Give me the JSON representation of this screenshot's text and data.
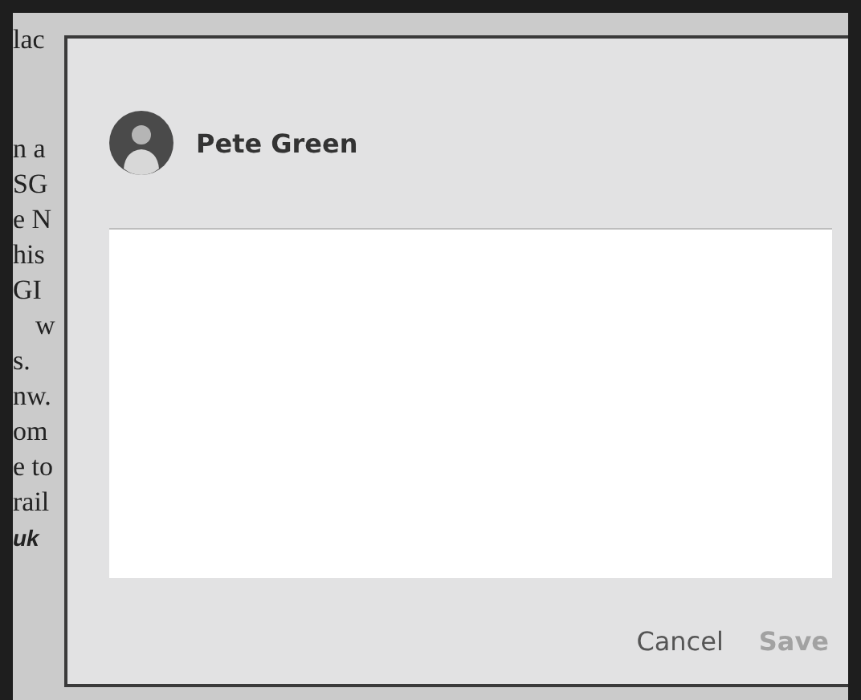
{
  "background_page": {
    "lines": [
      {
        "text": "lac",
        "kind": "plain"
      },
      {
        "text": "n a",
        "kind": "plain"
      },
      {
        "text": "SG",
        "kind": "plain"
      },
      {
        "text": "e N",
        "kind": "plain"
      },
      {
        "text": "his",
        "kind": "plain"
      },
      {
        "text": "GI",
        "kind": "plain"
      },
      {
        "text": "w",
        "kind": "indented"
      },
      {
        "text": "s.",
        "kind": "plain"
      },
      {
        "text": "nw.",
        "kind": "plain"
      },
      {
        "text": "om",
        "kind": "plain"
      },
      {
        "text": "e to",
        "kind": "plain"
      },
      {
        "text": "rail",
        "kind": "plain"
      },
      {
        "text": "uk",
        "kind": "link"
      }
    ]
  },
  "dialog": {
    "user_name": "Pete Green",
    "buttons": [
      {
        "label": "Cancel",
        "disabled": false
      },
      {
        "label": "Save",
        "disabled": true
      }
    ]
  }
}
